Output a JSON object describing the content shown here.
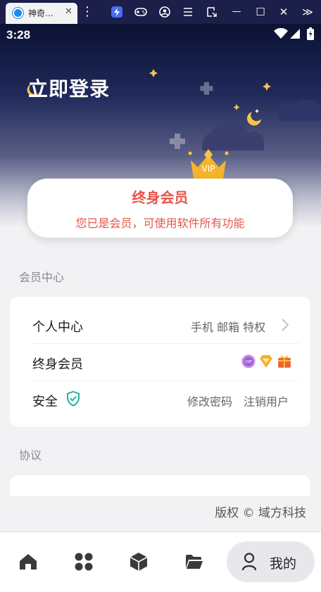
{
  "emulator": {
    "tab_title": "神奇…",
    "tab_close": "✕",
    "tab_icon": "app-icon",
    "toolbar_icons": [
      "more-vert-icon",
      "bolt-icon",
      "gamepad-icon",
      "account-icon",
      "menu-icon",
      "screen-crop-icon",
      "minimize-icon",
      "maximize-icon",
      "close-icon",
      "expand-icon"
    ],
    "glyphs": {
      "more": "⋮",
      "min": "—",
      "max": "☐",
      "close": "✕",
      "expand": "≫"
    }
  },
  "status_bar": {
    "time": "3:28",
    "icons": [
      "wifi-icon",
      "signal-icon",
      "battery-icon"
    ]
  },
  "header": {
    "login_label": "立即登录",
    "colors": {
      "top": "#0b1232",
      "moon": "#f6c24a",
      "cloud": "#3a3f6e"
    }
  },
  "membership_card": {
    "title": "终身会员",
    "subtitle": "您已是会员，可使用软件所有功能",
    "badge_text": "VIP",
    "accent": "#e8534a"
  },
  "member_center": {
    "section_label": "会员中心",
    "rows": [
      {
        "label": "个人中心",
        "right": "手机 邮箱 特权",
        "icon": "chevron-right-icon"
      },
      {
        "label": "终身会员",
        "badges": [
          "vip-badge-icon",
          "diamond-badge-icon",
          "gift-badge-icon"
        ]
      },
      {
        "label": "安全",
        "icon": "shield-check-icon",
        "actions": [
          "修改密码",
          "注销用户"
        ]
      }
    ]
  },
  "agreement": {
    "section_label": "协议"
  },
  "footer": {
    "copyright": "版权 © 域方科技"
  },
  "bottom_nav": {
    "items": [
      {
        "name": "home",
        "icon": "home-icon"
      },
      {
        "name": "apps",
        "icon": "apps-grid-icon"
      },
      {
        "name": "package",
        "icon": "cube-icon"
      },
      {
        "name": "folder",
        "icon": "folder-icon"
      },
      {
        "name": "me",
        "icon": "person-icon",
        "label": "我的",
        "active": true
      }
    ]
  }
}
